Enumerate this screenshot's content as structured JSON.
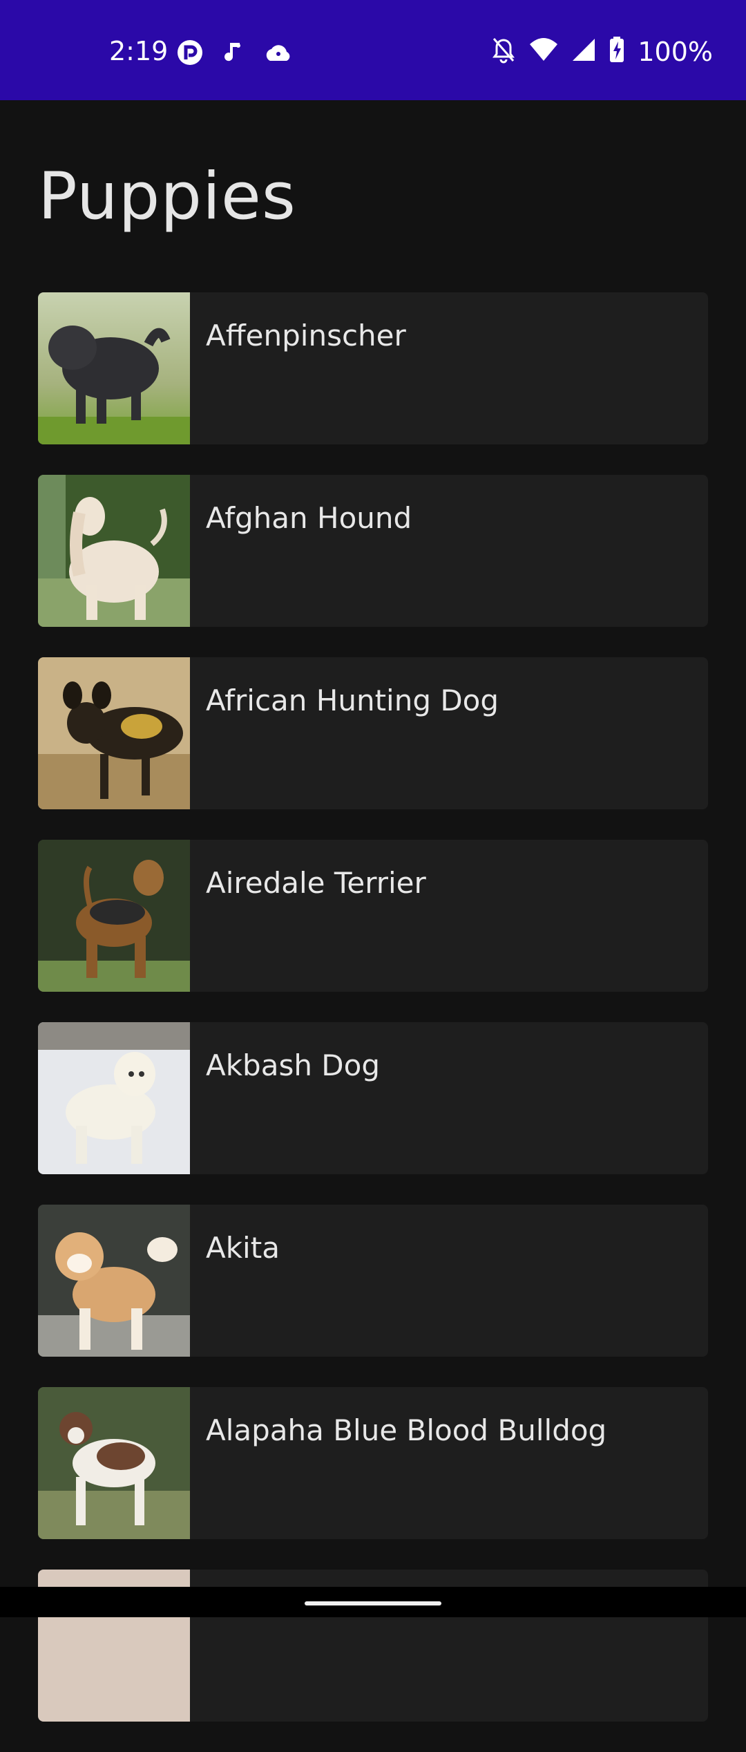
{
  "status_bar": {
    "time": "2:19",
    "battery": "100%",
    "left_icons": [
      "app-notification-icon",
      "music-notification-icon",
      "cloud-notification-icon"
    ],
    "right_icons": [
      "bell-off-icon",
      "wifi-icon",
      "cell-signal-icon",
      "battery-charging-icon"
    ],
    "color": "#2b09a8"
  },
  "page": {
    "title": "Puppies"
  },
  "breeds": [
    {
      "name": "Affenpinscher"
    },
    {
      "name": "Afghan Hound"
    },
    {
      "name": "African Hunting Dog"
    },
    {
      "name": "Airedale Terrier"
    },
    {
      "name": "Akbash Dog"
    },
    {
      "name": "Akita"
    },
    {
      "name": "Alapaha Blue Blood Bulldog"
    },
    {
      "name": ""
    }
  ],
  "colors": {
    "background": "#121212",
    "card": "#1e1e1e",
    "text": "#e8e8e8"
  }
}
